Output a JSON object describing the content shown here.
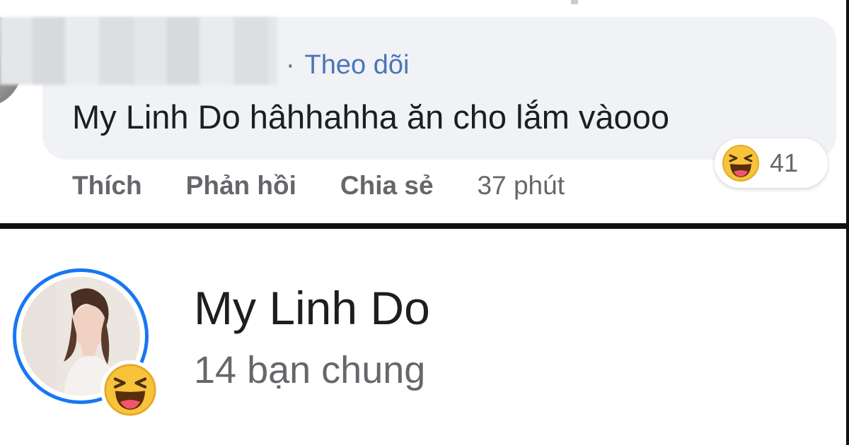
{
  "comment": {
    "follow_separator": "·",
    "follow_label": "Theo dõi",
    "mention": "My Linh Do",
    "text": " hâhhahha ăn cho lắm vàooo",
    "actions": {
      "like": "Thích",
      "reply": "Phản hồi",
      "share": "Chia sẻ",
      "time": "37 phút"
    },
    "reaction": {
      "icon": "haha-reaction-icon",
      "count": "41"
    }
  },
  "profile": {
    "name": "My Linh Do",
    "mutual_friends": "14 bạn chung",
    "reaction_icon": "haha-reaction-icon"
  },
  "colors": {
    "link_blue": "#4b75b8",
    "story_ring": "#1877f2",
    "bubble_bg": "#f0f2f5",
    "secondary_text": "#65676b",
    "reaction_yellow": "#f7c33b"
  }
}
